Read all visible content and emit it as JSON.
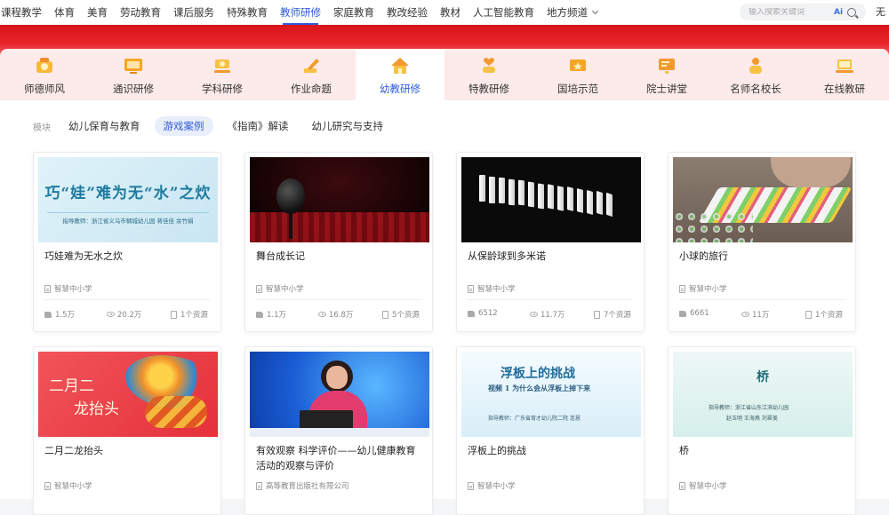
{
  "topnav": {
    "items": [
      "课程教学",
      "体育",
      "美育",
      "劳动教育",
      "课后服务",
      "特殊教育",
      "教师研修",
      "家庭教育",
      "教改经验",
      "教材",
      "人工智能教育",
      "地方频道"
    ],
    "active_index": 6,
    "search_placeholder": "输入搜索关键词",
    "ai_label": "Ai",
    "user_text": "无"
  },
  "categories": [
    {
      "label": "师德师风",
      "icon": "medal-icon"
    },
    {
      "label": "通识研修",
      "icon": "screen-icon"
    },
    {
      "label": "学科研修",
      "icon": "book-stand-icon"
    },
    {
      "label": "作业命题",
      "icon": "pen-icon"
    },
    {
      "label": "幼教研修",
      "icon": "house-icon"
    },
    {
      "label": "特教研修",
      "icon": "hand-heart-icon"
    },
    {
      "label": "国培示范",
      "icon": "flag-icon"
    },
    {
      "label": "院士讲堂",
      "icon": "board-icon"
    },
    {
      "label": "名师名校长",
      "icon": "person-icon"
    },
    {
      "label": "在线教研",
      "icon": "laptop-icon"
    }
  ],
  "active_category": 4,
  "filters": {
    "label": "模块",
    "chips": [
      "幼儿保育与教育",
      "游戏案例",
      "《指南》解读",
      "幼儿研究与支持"
    ],
    "active_index": 1
  },
  "cards": [
    {
      "title": "巧娃难为无水之炊",
      "publisher": "智慧中小学",
      "likes": "1.5万",
      "views": "20.2万",
      "resources": "1个资源",
      "cover": {
        "headline": "巧“娃”难为无“水”之炊",
        "subline": "指导教师：浙江省义乌市稠城幼儿园  蒋佳佳  余竹娟"
      }
    },
    {
      "title": "舞台成长记",
      "publisher": "智慧中小学",
      "likes": "1.1万",
      "views": "16.8万",
      "resources": "5个资源"
    },
    {
      "title": "从保龄球到多米诺",
      "publisher": "智慧中小学",
      "likes": "6512",
      "views": "11.7万",
      "resources": "7个资源"
    },
    {
      "title": "小球的旅行",
      "publisher": "智慧中小学",
      "likes": "6661",
      "views": "11万",
      "resources": "1个资源"
    },
    {
      "title": "二月二龙抬头",
      "publisher": "智慧中小学",
      "cover": {
        "line1": "二月二",
        "line2": "龙抬头"
      }
    },
    {
      "title": "有效观察 科学评价——幼儿健康教育活动的观察与评价",
      "publisher": "高等教育出版社有限公司"
    },
    {
      "title": "浮板上的挑战",
      "publisher": "智慧中小学",
      "cover": {
        "headline": "浮板上的挑战",
        "subline": "视频 1   为什么会从浮板上掉下来",
        "footer": "指导教师：广东省育才幼儿院二院   连慧"
      }
    },
    {
      "title": "桥",
      "publisher": "智慧中小学",
      "cover": {
        "headline": "桥",
        "subline": "指导教师：浙江省山东江滨幼儿园",
        "footer": "赵玉明  王海燕  刘翠美"
      }
    }
  ]
}
